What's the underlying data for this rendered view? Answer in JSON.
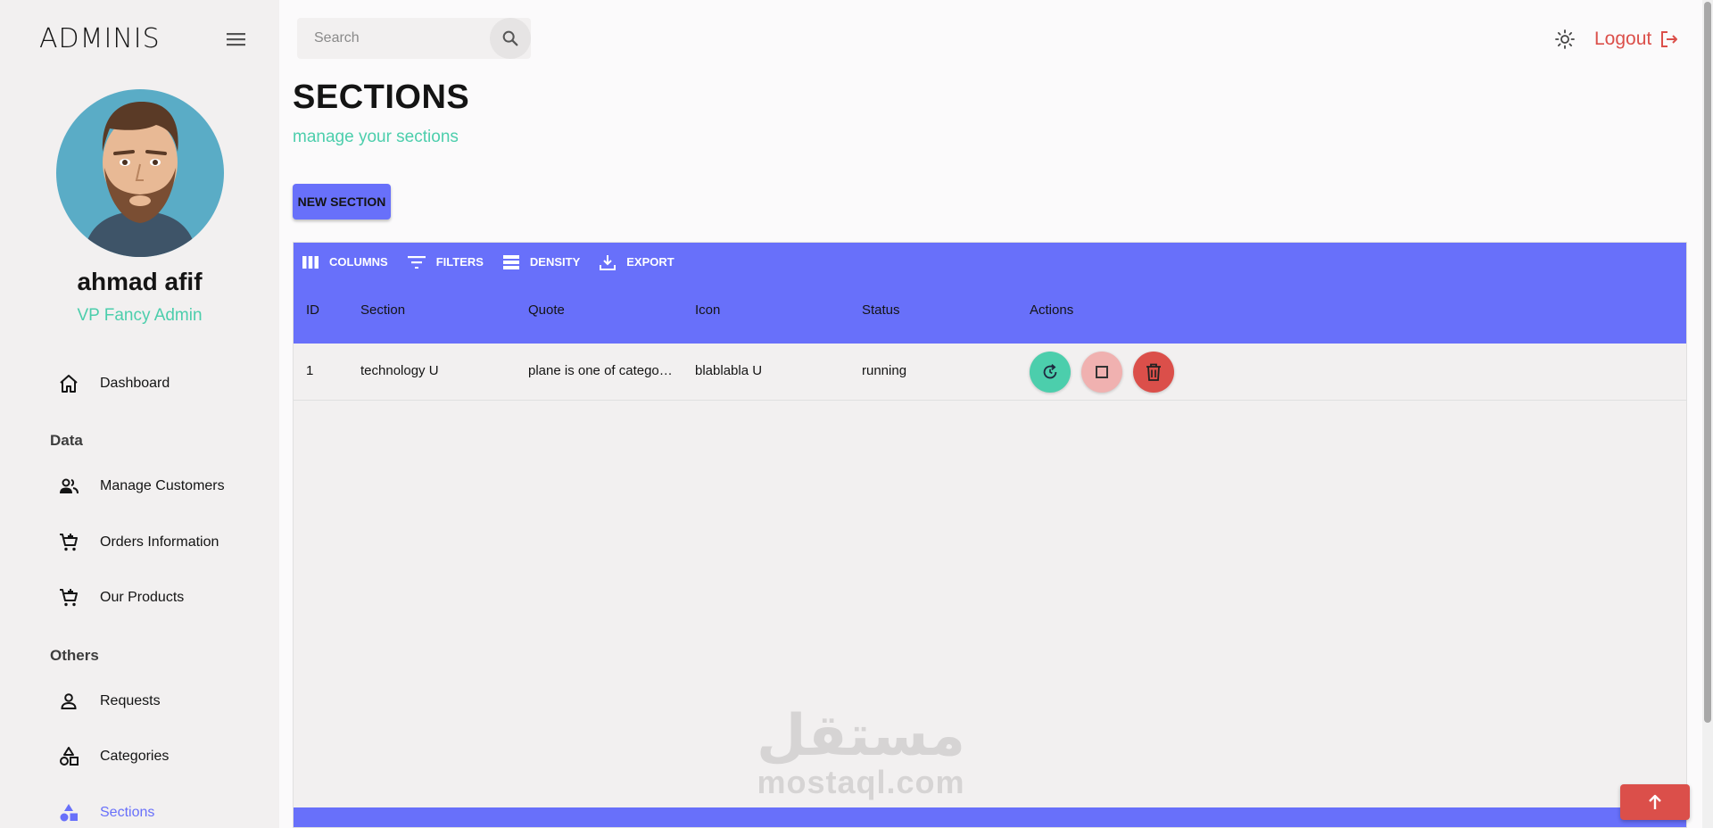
{
  "app": {
    "brand": "ADMINIS"
  },
  "user": {
    "name": "ahmad afif",
    "role": "VP Fancy Admin"
  },
  "sidebar": {
    "dashboard": "Dashboard",
    "section_data": "Data",
    "manage_customers": "Manage Customers",
    "orders_information": "Orders Information",
    "our_products": "Our Products",
    "section_others": "Others",
    "requests": "Requests",
    "categories": "Categories",
    "sections": "Sections"
  },
  "topbar": {
    "search_placeholder": "Search",
    "logout_label": "Logout"
  },
  "header": {
    "title": "SECTIONS",
    "subtitle": "manage your sections"
  },
  "new_section_label": "NEW SECTION",
  "grid": {
    "toolbar": {
      "columns": "COLUMNS",
      "filters": "FILTERS",
      "density": "DENSITY",
      "export": "EXPORT"
    },
    "columns": [
      "ID",
      "Section",
      "Quote",
      "Icon",
      "Status",
      "Actions"
    ],
    "rows": [
      {
        "id": "1",
        "section": "technology U",
        "quote": "plane is one of category of this section",
        "icon": "blablabla U",
        "status": "running"
      }
    ]
  },
  "watermark": {
    "arabic": "مستقل",
    "latin": "mostaql.com"
  },
  "colors": {
    "accent": "#6870fa",
    "green": "#4cceac",
    "red": "#db4f4a",
    "pink": "#f0b1b0"
  }
}
